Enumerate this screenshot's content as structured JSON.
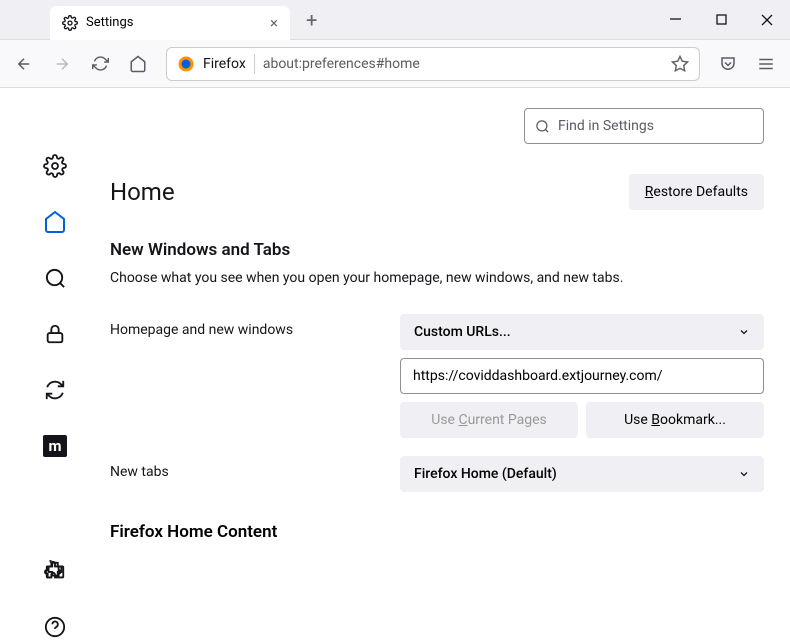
{
  "window": {
    "tab_title": "Settings",
    "url_label": "Firefox",
    "url": "about:preferences#home"
  },
  "search": {
    "placeholder": "Find in Settings"
  },
  "page": {
    "title": "Home",
    "restore_button": "Restore Defaults",
    "section1_title": "New Windows and Tabs",
    "section1_desc": "Choose what you see when you open your homepage, new windows, and new tabs.",
    "homepage_label": "Homepage and new windows",
    "homepage_select": "Custom URLs...",
    "homepage_url": "https://coviddashboard.extjourney.com/",
    "use_current": "Use Current Pages",
    "use_bookmark": "Use Bookmark...",
    "newtabs_label": "New tabs",
    "newtabs_select": "Firefox Home (Default)",
    "section2_title": "Firefox Home Content"
  }
}
